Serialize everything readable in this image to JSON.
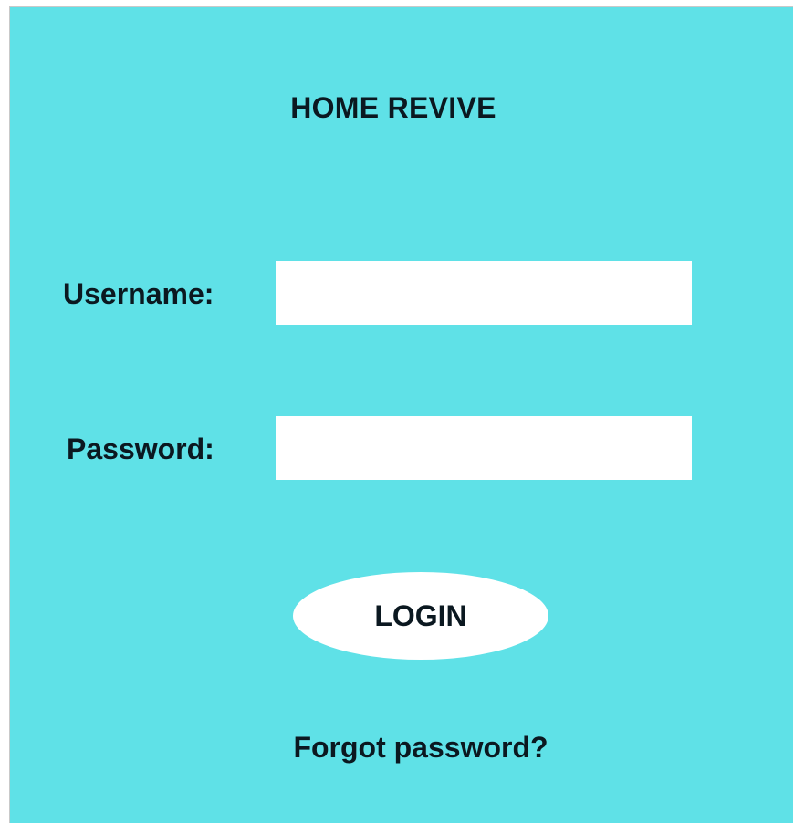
{
  "app": {
    "title": "HOME REVIVE"
  },
  "form": {
    "username_label": "Username:",
    "username_value": "",
    "password_label": "Password:",
    "password_value": "",
    "login_label": "LOGIN",
    "forgot_label": "Forgot password?"
  },
  "colors": {
    "background": "#5fe1e7",
    "field": "#ffffff",
    "text": "#0b1820"
  }
}
